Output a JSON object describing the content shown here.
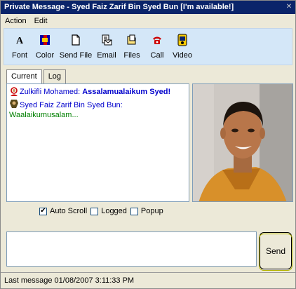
{
  "window": {
    "title": "Private Message - Syed Faiz Zarif Bin Syed Bun [I'm available!]",
    "close_glyph": "✕"
  },
  "menu": {
    "items": [
      "Action",
      "Edit"
    ]
  },
  "toolbar": {
    "items": [
      {
        "label": "Font",
        "icon": "font-icon"
      },
      {
        "label": "Color",
        "icon": "color-icon"
      },
      {
        "label": "Send File",
        "icon": "send-file-icon"
      },
      {
        "label": "Email",
        "icon": "email-icon"
      },
      {
        "label": "Files",
        "icon": "files-icon"
      },
      {
        "label": "Call",
        "icon": "call-icon"
      },
      {
        "label": "Video",
        "icon": "video-icon"
      }
    ]
  },
  "tabs": [
    {
      "label": "Current",
      "active": true
    },
    {
      "label": "Log",
      "active": false
    }
  ],
  "chat": {
    "messages": [
      {
        "sender": "Zulkifli Mohamed:",
        "text": "Assalamualaikum Syed!"
      },
      {
        "sender": "Syed Faiz Zarif Bin Syed Bun:",
        "text": "Waalaikumusalam..."
      }
    ]
  },
  "options": {
    "auto_scroll": {
      "label": "Auto Scroll",
      "checked": true
    },
    "logged": {
      "label": "Logged",
      "checked": false
    },
    "popup": {
      "label": "Popup",
      "checked": false
    }
  },
  "input": {
    "value": ""
  },
  "send_label": "Send",
  "status": {
    "text": "Last message 01/08/2007 3:11:33 PM"
  },
  "colors": {
    "titlebar": "#0a246a",
    "toolbar_bg": "#d4e7f8",
    "sender": "#0000cc",
    "reply": "#008000"
  }
}
